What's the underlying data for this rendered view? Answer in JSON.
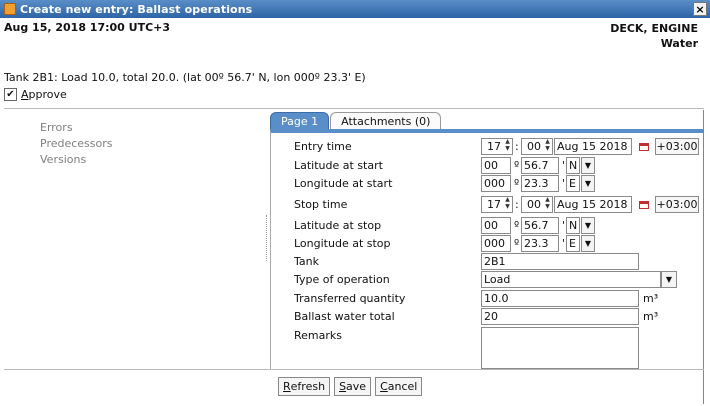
{
  "window": {
    "title": "Create new entry: Ballast operations",
    "close_label": "×"
  },
  "header": {
    "datetime": "Aug 15, 2018 17:00 UTC+3",
    "departments": "DECK, ENGINE",
    "category": "Water"
  },
  "summary": "Tank 2B1: Load 10.0, total 20.0. (lat 00º 56.7' N, lon 000º 23.3' E)",
  "approve": {
    "checked_mark": "✔",
    "mnemonic": "A",
    "label_rest": "pprove"
  },
  "left_panel": {
    "items": [
      "Errors",
      "Predecessors",
      "Versions"
    ]
  },
  "tabs": [
    {
      "label": "Page 1",
      "active": true
    },
    {
      "label": "Attachments (0)",
      "active": false
    }
  ],
  "form": {
    "entry_time": {
      "label": "Entry time",
      "hour": "17",
      "sep": ":",
      "minute": "00",
      "date": "Aug 15 2018",
      "tz": "+03:00"
    },
    "latitude_start": {
      "label": "Latitude at start",
      "deg": "00",
      "deg_sym": "º",
      "min": "56.7",
      "min_sym": "'",
      "hemi": "N"
    },
    "longitude_start": {
      "label": "Longitude at start",
      "deg": "000",
      "deg_sym": "º",
      "min": "23.3",
      "min_sym": "'",
      "hemi": "E"
    },
    "stop_time": {
      "label": "Stop time",
      "hour": "17",
      "sep": ":",
      "minute": "00",
      "date": "Aug 15 2018",
      "tz": "+03:00"
    },
    "latitude_stop": {
      "label": "Latitude at stop",
      "deg": "00",
      "deg_sym": "º",
      "min": "56.7",
      "min_sym": "'",
      "hemi": "N"
    },
    "longitude_stop": {
      "label": "Longitude at stop",
      "deg": "000",
      "deg_sym": "º",
      "min": "23.3",
      "min_sym": "'",
      "hemi": "E"
    },
    "tank": {
      "label": "Tank",
      "value": "2B1"
    },
    "type_of_operation": {
      "label": "Type of operation",
      "value": "Load"
    },
    "transferred_quantity": {
      "label": "Transferred quantity",
      "value": "10.0",
      "unit": "m³"
    },
    "ballast_water_total": {
      "label": "Ballast water total",
      "value": "20",
      "unit": "m³"
    },
    "remarks": {
      "label": "Remarks",
      "value": ""
    }
  },
  "footer": {
    "refresh": {
      "mnemonic": "R",
      "rest": "efresh"
    },
    "save": {
      "mnemonic": "S",
      "rest": "ave"
    },
    "cancel": {
      "mnemonic": "C",
      "rest": "ancel"
    }
  },
  "icons": {
    "spin_up": "▲",
    "spin_down": "▼",
    "dropdown": "▼"
  },
  "colors": {
    "accent": "#5a8ec8",
    "titlebar": "#2d64a6"
  }
}
